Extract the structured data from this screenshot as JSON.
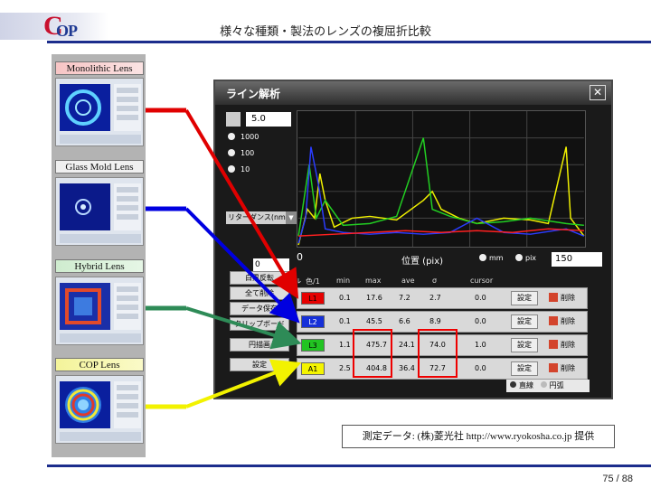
{
  "header": {
    "logo_c": "C",
    "logo_op": "OP",
    "title": "様々な種類・製法のレンズの複屈折比較"
  },
  "samples": [
    {
      "label": "Monolithic Lens",
      "color": "#e00000"
    },
    {
      "label": "Glass Mold Lens",
      "color": "#0000e0"
    },
    {
      "label": "Hybrid Lens",
      "color": "#2e8b57"
    },
    {
      "label": "COP Lens",
      "color": "#f2f200"
    }
  ],
  "window": {
    "title": "ライン解析",
    "close": "✕",
    "spin_value": "5.0",
    "radios": [
      "1000",
      "100",
      "10"
    ],
    "dropdown": "リターダンス(nm)",
    "small_field": "0",
    "checkbox": "自動スケール",
    "min_value": "0",
    "position_label": "位置 (pix)",
    "unit_mm": "mm",
    "unit_pix": "pix",
    "position_value": "150",
    "side_buttons": [
      "白黒反転",
      "全て削除",
      "データ保存",
      "クリップボード",
      "円描画",
      "設定"
    ],
    "col_headers": [
      "色/1",
      "min",
      "max",
      "ave",
      "σ",
      "cursor"
    ],
    "rows": [
      {
        "swatch": "L1",
        "color": "#e60000",
        "min": "0.1",
        "max": "17.6",
        "ave": "7.2",
        "sd": "2.7",
        "cursor": "0.0",
        "set": "設定",
        "del": "削除"
      },
      {
        "swatch": "L2",
        "color": "#1630d8",
        "min": "0.1",
        "max": "45.5",
        "ave": "6.6",
        "sd": "8.9",
        "cursor": "0.0",
        "set": "設定",
        "del": "削除"
      },
      {
        "swatch": "L3",
        "color": "#22c422",
        "min": "1.1",
        "max": "475.7",
        "ave": "24.1",
        "sd": "74.0",
        "cursor": "1.0",
        "set": "設定",
        "del": "削除"
      },
      {
        "swatch": "A1",
        "color": "#f4f400",
        "min": "2.5",
        "max": "404.8",
        "ave": "36.4",
        "sd": "72.7",
        "cursor": "0.0",
        "set": "設定",
        "del": "削除"
      }
    ],
    "toggle_a": "直線",
    "toggle_b": "円弧"
  },
  "credit": "測定データ: (株)菱光社 http://www.ryokosha.co.jp 提供",
  "page_number": "75 / 88"
}
